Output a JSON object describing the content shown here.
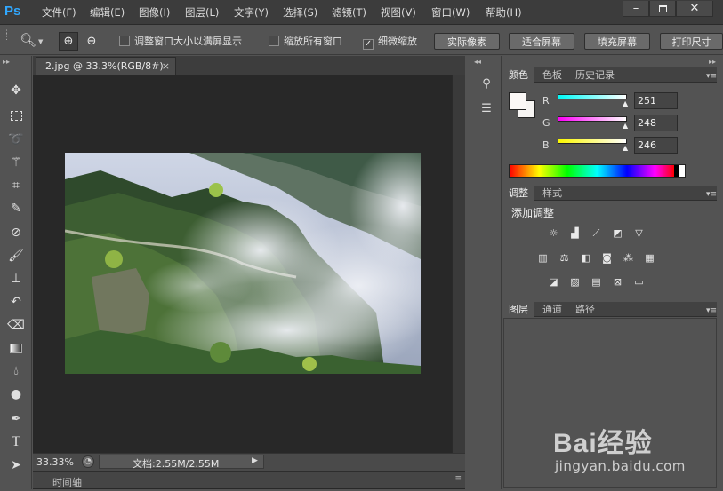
{
  "app": {
    "logo": "Ps"
  },
  "menu": [
    "文件(F)",
    "编辑(E)",
    "图像(I)",
    "图层(L)",
    "文字(Y)",
    "选择(S)",
    "滤镜(T)",
    "视图(V)",
    "窗口(W)",
    "帮助(H)"
  ],
  "options": {
    "fit_all_label": "调整窗口大小以满屏显示",
    "zoom_all_label": "缩放所有窗口",
    "scrubby_label": "细微缩放",
    "actual_pixels": "实际像素",
    "fit_screen": "适合屏幕",
    "fill_screen": "填充屏幕",
    "print_size": "打印尺寸"
  },
  "document": {
    "tab_title": "2.jpg @ 33.3%(RGB/8#)",
    "zoom": "33.33%",
    "doc_size": "文档:2.55M/2.55M",
    "timeline_label": "时间轴"
  },
  "color_panel": {
    "tabs": [
      "颜色",
      "色板",
      "历史记录"
    ],
    "r_label": "R",
    "g_label": "G",
    "b_label": "B",
    "r": "251",
    "g": "248",
    "b": "246"
  },
  "adjust_panel": {
    "tabs": [
      "调整",
      "样式"
    ],
    "title": "添加调整"
  },
  "layers_panel": {
    "tabs": [
      "图层",
      "通道",
      "路径"
    ]
  },
  "watermark": {
    "text": "Bai经验",
    "url": "jingyan.baidu.com"
  }
}
